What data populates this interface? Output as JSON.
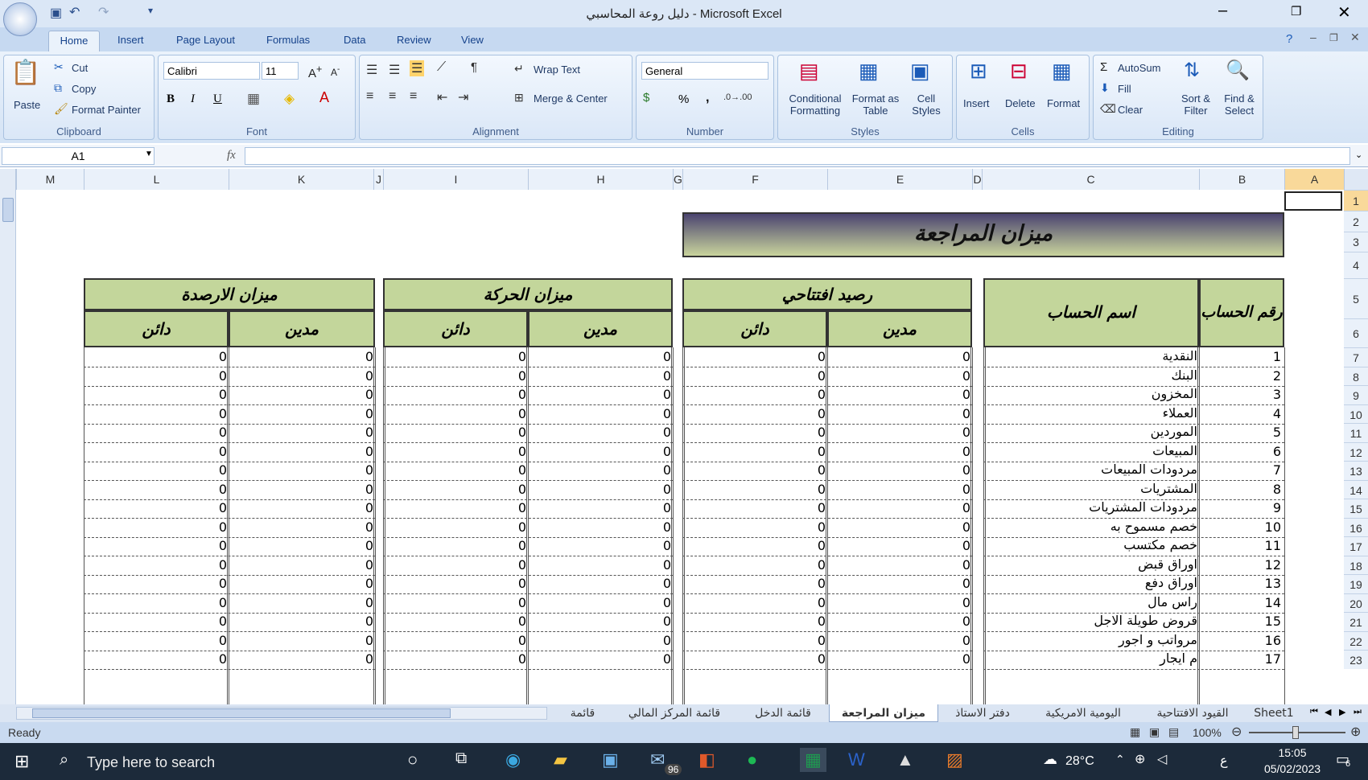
{
  "window": {
    "title": "دليل روعة المحاسبي - Microsoft Excel"
  },
  "ribbon_tabs": [
    "Home",
    "Insert",
    "Page Layout",
    "Formulas",
    "Data",
    "Review",
    "View"
  ],
  "clipboard": {
    "paste": "Paste",
    "cut": "Cut",
    "copy": "Copy",
    "format_painter": "Format Painter",
    "label": "Clipboard"
  },
  "font": {
    "name": "Calibri",
    "size": "11",
    "label": "Font",
    "bold": "B",
    "italic": "I",
    "underline": "U"
  },
  "alignment": {
    "wrap": "Wrap Text",
    "merge": "Merge & Center",
    "label": "Alignment"
  },
  "number": {
    "format": "General",
    "label": "Number",
    "percent": "%",
    "comma": ","
  },
  "styles": {
    "cond": "Conditional Formatting",
    "table": "Format as Table",
    "cell": "Cell Styles",
    "label": "Styles"
  },
  "cells": {
    "insert": "Insert",
    "delete": "Delete",
    "format": "Format",
    "label": "Cells"
  },
  "editing": {
    "autosum": "AutoSum",
    "fill": "Fill",
    "clear": "Clear",
    "sort": "Sort & Filter",
    "find": "Find & Select",
    "label": "Editing"
  },
  "formula_bar": {
    "name_box": "A1",
    "fx": "fx",
    "value": ""
  },
  "columns": [
    "M",
    "L",
    "K",
    "J",
    "I",
    "H",
    "G",
    "F",
    "E",
    "D",
    "C",
    "B",
    "A"
  ],
  "sheet": {
    "title": "ميزان المراجعة",
    "sec_opening": "رصيد افتتاحي",
    "sec_movement": "ميزان الحركة",
    "sec_balances": "ميزان الارصدة",
    "debit": "مدين",
    "credit": "دائن",
    "acct_no": "رقم الحساب",
    "acct_name": "اسم الحساب",
    "zero": "0",
    "rows": [
      {
        "r": "7",
        "no": "1",
        "name": "النقدية"
      },
      {
        "r": "8",
        "no": "2",
        "name": "البنك"
      },
      {
        "r": "9",
        "no": "3",
        "name": "المخزون"
      },
      {
        "r": "10",
        "no": "4",
        "name": "العملاء"
      },
      {
        "r": "11",
        "no": "5",
        "name": "الموردين"
      },
      {
        "r": "12",
        "no": "6",
        "name": "المبيعات"
      },
      {
        "r": "13",
        "no": "7",
        "name": "مردودات المبيعات"
      },
      {
        "r": "14",
        "no": "8",
        "name": "المشتريات"
      },
      {
        "r": "15",
        "no": "9",
        "name": "مردودات المشتريات"
      },
      {
        "r": "16",
        "no": "10",
        "name": "خصم مسموح به"
      },
      {
        "r": "17",
        "no": "11",
        "name": "خصم مكتسب"
      },
      {
        "r": "18",
        "no": "12",
        "name": "اوراق قبض"
      },
      {
        "r": "19",
        "no": "13",
        "name": "اوراق دفع"
      },
      {
        "r": "20",
        "no": "14",
        "name": "راس مال"
      },
      {
        "r": "21",
        "no": "15",
        "name": "قروض طويلة الاجل"
      },
      {
        "r": "22",
        "no": "16",
        "name": "مرواتب و اجور"
      },
      {
        "r": "23",
        "no": "17",
        "name": "م ايجار"
      }
    ],
    "header_rows": [
      "1",
      "2",
      "3",
      "4",
      "5",
      "6"
    ]
  },
  "sheet_tabs": [
    "Sheet1",
    "القيود الافتتاحية",
    "اليومية الامريكية",
    "دفتر الاستاذ",
    "ميزان المراجعة",
    "قائمة الدخل",
    "قائمة المركز المالي",
    "قائمة"
  ],
  "status": {
    "ready": "Ready",
    "zoom": "100%"
  },
  "taskbar": {
    "search": "Type here to search",
    "temp": "28°C",
    "time": "15:05",
    "date": "05/02/2023",
    "lang": "ع",
    "badge": "96",
    "notif": "6"
  }
}
